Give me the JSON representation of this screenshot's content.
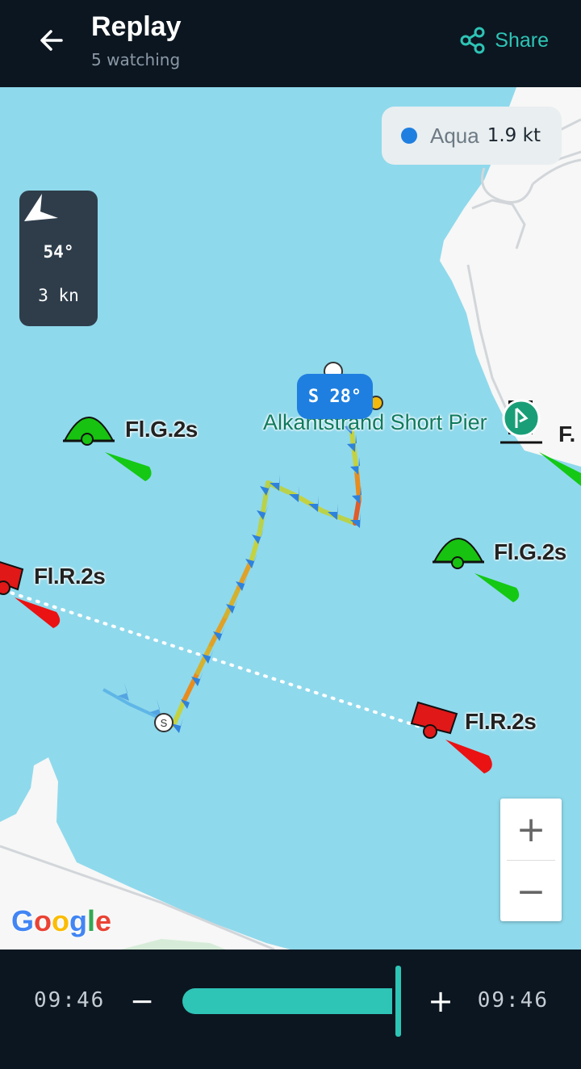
{
  "header": {
    "title": "Replay",
    "subtitle": "5 watching",
    "share_label": "Share"
  },
  "boat": {
    "name": "Aqua",
    "speed": "1.9 kt",
    "color": "#1f7fe0"
  },
  "wind": {
    "direction": "54°",
    "speed": "3 kn"
  },
  "heading_bubble": "S 28°",
  "markers": {
    "buoy_green_1": "Fl.G.2s",
    "buoy_green_2": "Fl.G.2s",
    "buoy_red_1": "Fl.R.2s",
    "buoy_red_2": "Fl.R.2s",
    "pier_label": "Alkantstrand Short Pier",
    "edge_label": "F."
  },
  "map_attribution": "Google",
  "zoom": {
    "in_label": "+",
    "out_label": "−"
  },
  "playback": {
    "time_start": "09:46",
    "time_end": "09:46",
    "minus_label": "−",
    "plus_label": "+",
    "progress": 0.97,
    "accent_color": "#2ec4b6"
  }
}
